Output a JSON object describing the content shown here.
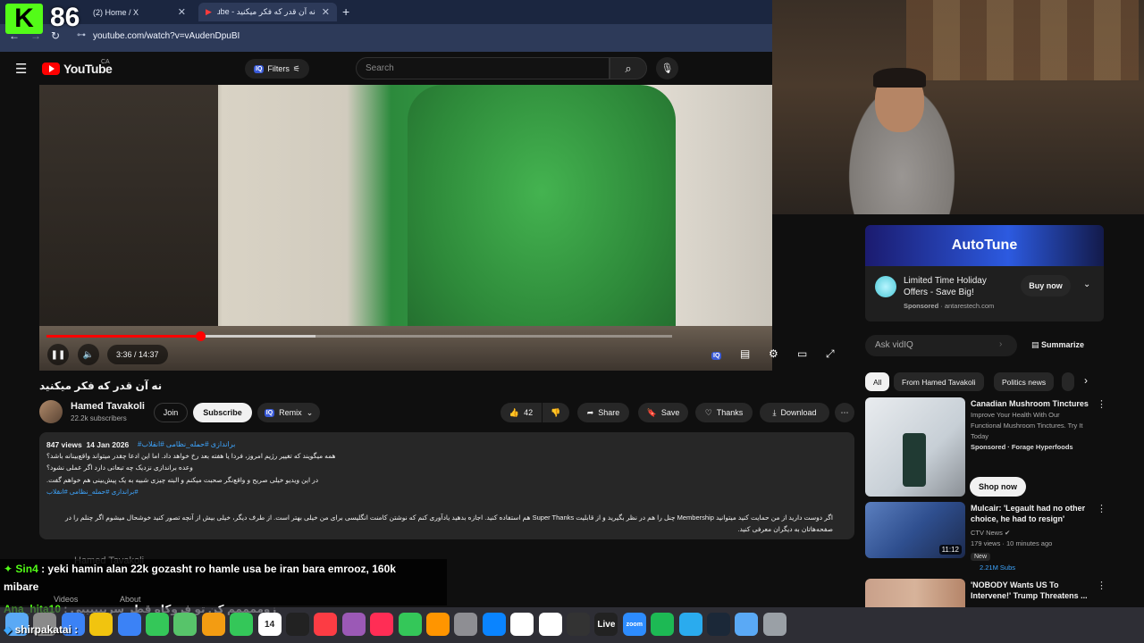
{
  "stream_overlay": {
    "kick_logo": "K",
    "viewer_count": "86",
    "chat": [
      {
        "user": "Sin4",
        "text": "yeki hamin alan 22k gozasht ro hamle usa be iran bara emrooz, 160k"
      },
      {
        "user": "",
        "text": "mibare"
      },
      {
        "user": "Ana_hita10",
        "text": "زوممممم کن تو فروکاه قطر سربیییییی"
      },
      {
        "user": "shirpakatai",
        "text": ""
      }
    ]
  },
  "browser": {
    "tabs": [
      {
        "label": "(2) Home / X"
      },
      {
        "label": "نه آن قدر که فکر میکنید - YouTube"
      }
    ],
    "url": "youtube.com/watch?v=vAudenDpuBI"
  },
  "youtube": {
    "logo_text": "YouTube",
    "country": "CA",
    "filters_label": "Filters",
    "vq_badge": "IQ",
    "search_placeholder": "Search",
    "player": {
      "progress_fraction": 0.245,
      "buffer_fraction": 0.43,
      "time": "3:36 / 14:37"
    },
    "video_title": "نه آن قدر که فکر میکنید",
    "channel": {
      "name": "Hamed Tavakoli",
      "subscribers": "22.2k subscribers",
      "join_label": "Join",
      "subscribe_label": "Subscribe",
      "remix_label": "Remix"
    },
    "actions": {
      "likes": "42",
      "share": "Share",
      "save": "Save",
      "thanks": "Thanks",
      "download": "Download"
    },
    "description": {
      "views": "847 views",
      "date": "14 Jan 2026",
      "tags_line": "#براندازی #حمله_نظامی #انقلاب",
      "lines": [
        "همه میگویند که تغییر رژیم امروز، فردا یا هفته بعد رخ خواهد داد. اما این ادعا چقدر میتواند واقع‌بینانه باشد؟",
        "وعده براندازی نزدیک چه تبعاتی دارد اگر عملی نشود؟",
        "در این ویدیو خیلی صریح و واقع‌نگر صحبت میکنم و البته چیزی شبیه به یک پیش‌بینی هم خواهم گفت."
      ],
      "tags_line2": "#براندازی #حمله_نظامی #انقلاب",
      "long_text": "اگر دوست دارید از من حمایت کنید میتوانید Membership چنل را هم در نظر بگیرید و از قابلیت Super Thanks هم استفاده کنید. اجازه بدهید یادآوری کنم که نوشتن کامنت انگلیسی برای من خیلی بهتر است. از طرف دیگر، خیلی بیش از آنچه تصور کنید خوشحال میشوم اگر چنلم را در صفحه‌هاتان به دیگران معرفی کنید."
    },
    "channel_card_name": "Hamed Tavakoli",
    "channel_tabs": [
      "Videos",
      "About"
    ]
  },
  "sidebar": {
    "ad": {
      "brand": "AutoTune",
      "title": "Limited Time Holiday Offers - Save Big!",
      "sponsored": "Sponsored",
      "domain": "antarestech.com",
      "buy_label": "Buy now"
    },
    "ask_placeholder": "Ask vidIQ",
    "summarize_label": "Summarize",
    "chips": [
      "All",
      "From Hamed Tavakoli",
      "Politics news"
    ],
    "recommendations": [
      {
        "title": "Canadian Mushroom Tinctures",
        "subtitle": "Improve Your Health With Our Functional Mushroom Tinctures. Try It Today",
        "sponsor": "Sponsored · Forage Hyperfoods",
        "cta": "Shop now"
      },
      {
        "title": "Mulcair: 'Legault had no other choice, he had to resign'",
        "channel": "CTV News",
        "meta": "179 views · 10 minutes ago",
        "badge": "New",
        "subs": "2.21M Subs",
        "duration": "11:12"
      },
      {
        "title": "'NOBODY Wants US To Intervene!' Trump Threatens ..."
      }
    ]
  },
  "dock": {
    "items": [
      "Finder",
      "Launchpad",
      "Safari",
      "Chrome",
      "Mail",
      "Messages",
      "Maps",
      "Photos",
      "FaceTime",
      "Calendar",
      "TV",
      "Music",
      "Podcasts",
      "News",
      "Numbers",
      "Pages",
      "Settings",
      "App Store",
      "Notion",
      "Calendar2",
      "Logic",
      "Live",
      "Zoom",
      "Spotify",
      "Telegram",
      "Steam",
      "Finder2",
      "Trash"
    ],
    "live_label": "Live",
    "zoom_label": "zoom",
    "calendar_day": "14"
  }
}
